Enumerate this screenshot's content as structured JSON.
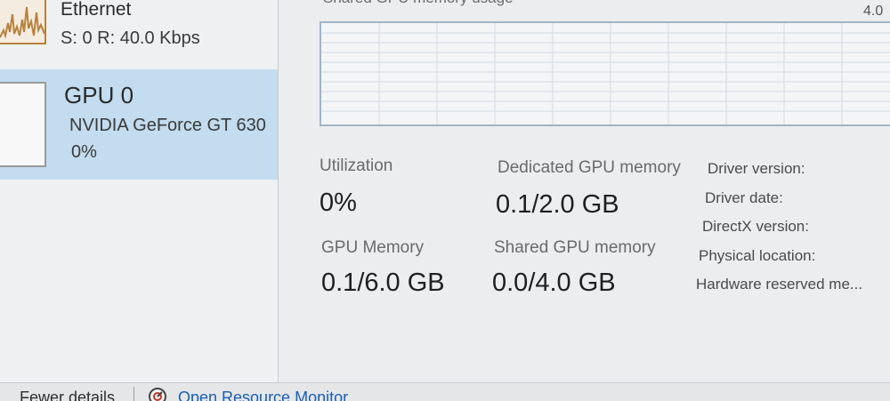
{
  "sidebar": {
    "ethernet": {
      "title": "Ethernet",
      "stats": "S: 0 R: 40.0 Kbps"
    },
    "gpu": {
      "title": "GPU 0",
      "name": "NVIDIA GeForce GT 630",
      "utilization": "0%"
    }
  },
  "graph": {
    "caption": "Shared GPU memory usage",
    "max_label": "4.0"
  },
  "stats": {
    "utilization_label": "Utilization",
    "utilization_value": "0%",
    "dedicated_label": "Dedicated GPU memory",
    "dedicated_value": "0.1/2.0 GB",
    "gpu_memory_label": "GPU Memory",
    "gpu_memory_value": "0.1/6.0 GB",
    "shared_label": "Shared GPU memory",
    "shared_value": "0.0/4.0 GB"
  },
  "info_labels": [
    "Driver version:",
    "Driver date:",
    "DirectX version:",
    "Physical location:",
    "Hardware reserved me..."
  ],
  "footer": {
    "fewer_details": "Fewer details",
    "open_resource_monitor": "Open Resource Monitor"
  },
  "colors": {
    "selected_bg": "#c3dcef",
    "ethernet_accent": "#b7813d",
    "graph_border": "#9fb4c8",
    "link": "#1a5fb4"
  },
  "icons": {
    "resource_monitor": "resource-monitor-icon"
  }
}
